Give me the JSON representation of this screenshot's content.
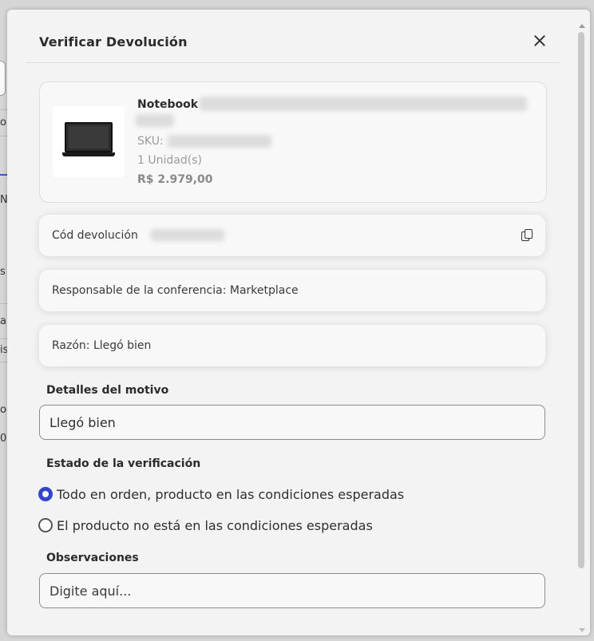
{
  "modal": {
    "title": "Verificar Devolución"
  },
  "product": {
    "name": "Notebook",
    "sku_label": "SKU:",
    "quantity": "1 Unidad(s)",
    "price": "R$ 2.979,00",
    "image_icon": "laptop-image"
  },
  "return_code": {
    "label": "Cód devolución"
  },
  "responsible": {
    "text": "Responsable de la conferencia: Marketplace"
  },
  "reason": {
    "text": "Razón: Llegó bien"
  },
  "details": {
    "label": "Detalles del motivo",
    "value": "Llegó bien"
  },
  "verification": {
    "label": "Estado de la verificación",
    "options": [
      {
        "label": "Todo en orden, producto en las condiciones esperadas",
        "selected": true
      },
      {
        "label": "El producto no está en las condiciones esperadas",
        "selected": false
      }
    ]
  },
  "observations": {
    "label": "Observaciones",
    "placeholder": "Digite aquí..."
  },
  "background_fragments": [
    "o",
    "N",
    "s",
    "a",
    "is",
    "oc",
    "0"
  ],
  "colors": {
    "accent": "#3045d6",
    "modal_bg": "#f3f3f3",
    "overlay": "#d6d6d6"
  }
}
